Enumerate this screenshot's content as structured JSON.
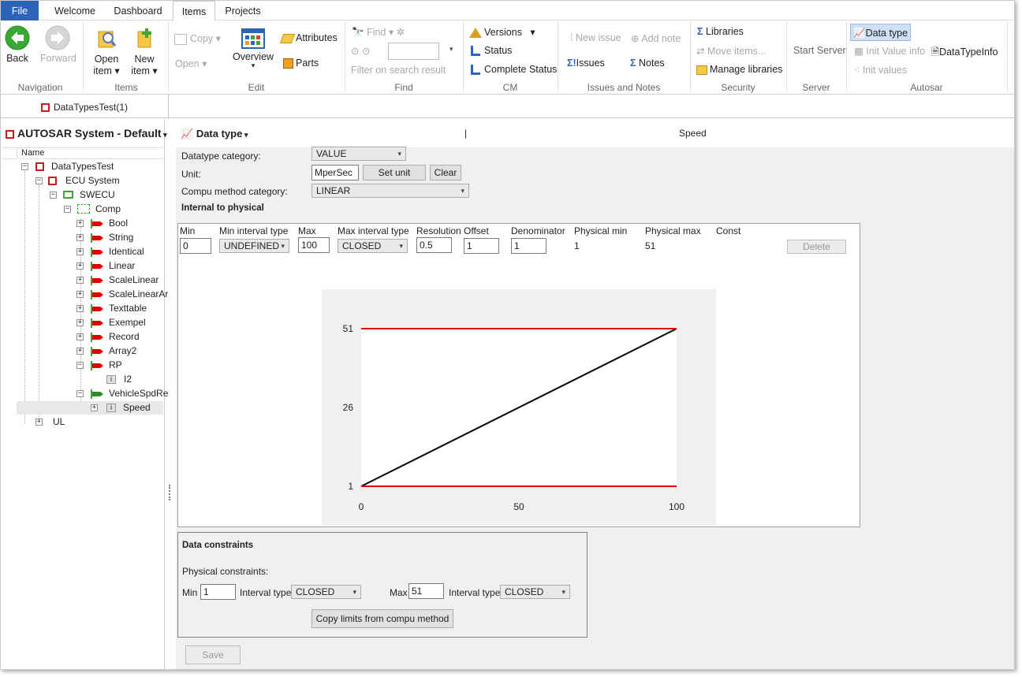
{
  "menu": {
    "file": "File",
    "welcome": "Welcome",
    "dashboard": "Dashboard",
    "items": "Items",
    "projects": "Projects"
  },
  "ribbon": {
    "navigation": {
      "back": "Back",
      "forward": "Forward",
      "group": "Navigation"
    },
    "items": {
      "open": "Open",
      "open2": "item",
      "new": "New",
      "new2": "item",
      "group": "Items"
    },
    "edit": {
      "copy": "Copy",
      "open": "Open",
      "overview": "Overview",
      "attributes": "Attributes",
      "parts": "Parts",
      "group": "Edit"
    },
    "find": {
      "find": "Find",
      "filter": "Filter on search result",
      "group": "Find"
    },
    "cm": {
      "versions": "Versions",
      "status": "Status",
      "complete": "Complete Status",
      "group": "CM"
    },
    "issues": {
      "new_issue": "New issue",
      "add_note": "Add note",
      "issues": "Issues",
      "notes": "Notes",
      "group": "Issues and Notes"
    },
    "security": {
      "libraries": "Libraries",
      "move": "Move items...",
      "manage": "Manage libraries",
      "group": "Security"
    },
    "server": {
      "start": "Start Server",
      "group": "Server"
    },
    "autosar": {
      "datatype": "Data type",
      "init_value_info": "Init Value info",
      "datatypeinfo": "DataTypeInfo",
      "init_values": "Init values",
      "group": "Autosar"
    }
  },
  "doc_tab": "DataTypesTest(1)",
  "tree": {
    "title": "AUTOSAR System - Default",
    "column": "Name",
    "root": "DataTypesTest",
    "ecu": "ECU System",
    "swecu": "SWECU",
    "comp": "Comp",
    "children": [
      "Bool",
      "String",
      "Identical",
      "Linear",
      "ScaleLinear",
      "ScaleLinearAr",
      "Texttable",
      "Exempel",
      "Record",
      "Array2",
      "RP"
    ],
    "rp_child": "I2",
    "vehicle": "VehicleSpdRe",
    "speed": "Speed",
    "ul": "UL"
  },
  "header": {
    "title": "Data type",
    "sep": "|",
    "name": "Speed"
  },
  "form": {
    "datatype_category_label": "Datatype category:",
    "datatype_category": "VALUE",
    "unit_label": "Unit:",
    "unit": "MperSec",
    "set_unit": "Set unit",
    "clear": "Clear",
    "compu_label": "Compu method category:",
    "compu": "LINEAR",
    "i2p": "Internal to physical"
  },
  "table": {
    "headers": [
      "Min",
      "Min interval type",
      "Max",
      "Max interval type",
      "Resolution",
      "Offset",
      "Denominator",
      "Physical min",
      "Physical max",
      "Const"
    ],
    "row": {
      "min": "0",
      "min_type": "UNDEFINED",
      "max": "100",
      "max_type": "CLOSED",
      "resolution": "0.5",
      "offset": "1",
      "denominator": "1",
      "phys_min": "1",
      "phys_max": "51"
    },
    "delete": "Delete"
  },
  "chart_data": {
    "type": "line",
    "series": [
      {
        "values": [
          [
            0,
            1
          ],
          [
            100,
            51
          ]
        ],
        "color": "#000000"
      },
      {
        "values": [
          [
            0,
            51
          ],
          [
            100,
            51
          ]
        ],
        "color": "#e00000"
      },
      {
        "values": [
          [
            0,
            1
          ],
          [
            100,
            1
          ]
        ],
        "color": "#e00000"
      }
    ],
    "xlim": [
      0,
      100
    ],
    "ylim": [
      1,
      51
    ],
    "xticks": [
      "0",
      "50",
      "100"
    ],
    "yticks": [
      "1",
      "26",
      "51"
    ],
    "grid": false,
    "background": "#f0f0f0"
  },
  "constraints": {
    "title": "Data constraints",
    "physical": "Physical constraints:",
    "min_label": "Min",
    "min": "1",
    "interval_label": "Interval type",
    "min_type": "CLOSED",
    "max_label": "Max",
    "max": "51",
    "max_type": "CLOSED",
    "copy": "Copy limits from compu method"
  },
  "save": "Save"
}
